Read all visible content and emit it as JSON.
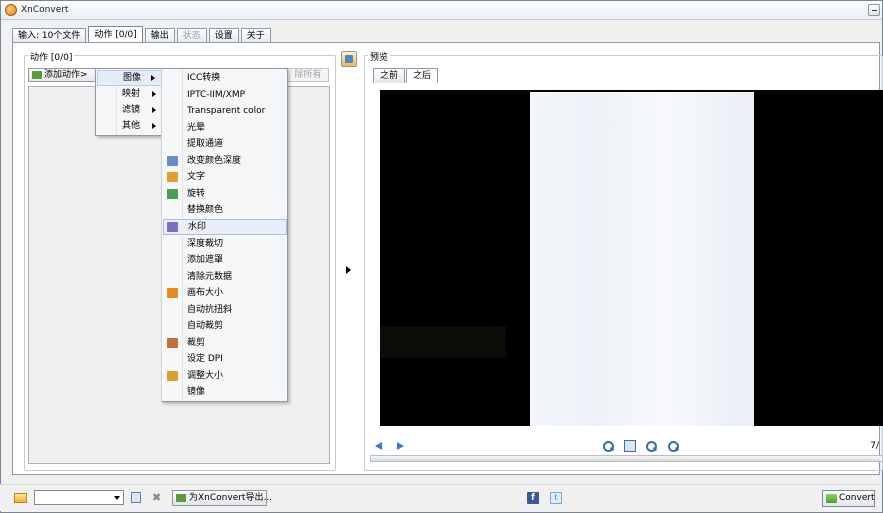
{
  "app": {
    "title": "XnConvert"
  },
  "tabs": [
    {
      "label": "输入: 10个文件",
      "active": false,
      "disabled": false
    },
    {
      "label": "动作 [0/0]",
      "active": true,
      "disabled": false
    },
    {
      "label": "输出",
      "active": false,
      "disabled": false
    },
    {
      "label": "状态",
      "active": false,
      "disabled": true
    },
    {
      "label": "设置",
      "active": false,
      "disabled": false
    },
    {
      "label": "关于",
      "active": false,
      "disabled": false
    }
  ],
  "actions_panel": {
    "group_label": "动作 [0/0]",
    "add_action_label": "添加动作>",
    "remove_all_label": "除所有"
  },
  "category_menu": {
    "items": [
      {
        "label": "图像",
        "active": true
      },
      {
        "label": "映射",
        "active": false
      },
      {
        "label": "滤镜",
        "active": false
      },
      {
        "label": "其他",
        "active": false
      }
    ]
  },
  "image_submenu": {
    "items": [
      {
        "label": "ICC转换",
        "icon": ""
      },
      {
        "label": "IPTC-IIM/XMP",
        "icon": ""
      },
      {
        "label": "Transparent color",
        "icon": ""
      },
      {
        "label": "光晕",
        "icon": ""
      },
      {
        "label": "提取通道",
        "icon": ""
      },
      {
        "label": "改变颜色深度",
        "icon": "color-depth-icon",
        "color": "#6a8cc7"
      },
      {
        "label": "文字",
        "icon": "text-icon",
        "color": "#e0a030"
      },
      {
        "label": "旋转",
        "icon": "rotate-icon",
        "color": "#4aa056"
      },
      {
        "label": "替换颜色",
        "icon": ""
      },
      {
        "label": "水印",
        "icon": "watermark-icon",
        "color": "#7a6fc0",
        "hover": true
      },
      {
        "label": "深度裁切",
        "icon": ""
      },
      {
        "label": "添加遮罩",
        "icon": ""
      },
      {
        "label": "清除元数据",
        "icon": ""
      },
      {
        "label": "画布大小",
        "icon": "canvas-size-icon",
        "color": "#e88a2a"
      },
      {
        "label": "自动抗扭斜",
        "icon": ""
      },
      {
        "label": "自动裁剪",
        "icon": ""
      },
      {
        "label": "裁剪",
        "icon": "crop-icon",
        "color": "#c0703a"
      },
      {
        "label": "设定 DPI",
        "icon": ""
      },
      {
        "label": "调整大小",
        "icon": "resize-icon",
        "color": "#d8a032"
      },
      {
        "label": "镜像",
        "icon": ""
      }
    ]
  },
  "preview": {
    "group_label": "预览",
    "tabs": [
      {
        "label": "之前",
        "active": false
      },
      {
        "label": "之后",
        "active": true
      }
    ],
    "page_indicator": "7/"
  },
  "bottom_bar": {
    "export_label": "为XnConvert导出...",
    "convert_label": "Convert",
    "facebook_glyph": "f",
    "twitter_glyph": "t"
  }
}
